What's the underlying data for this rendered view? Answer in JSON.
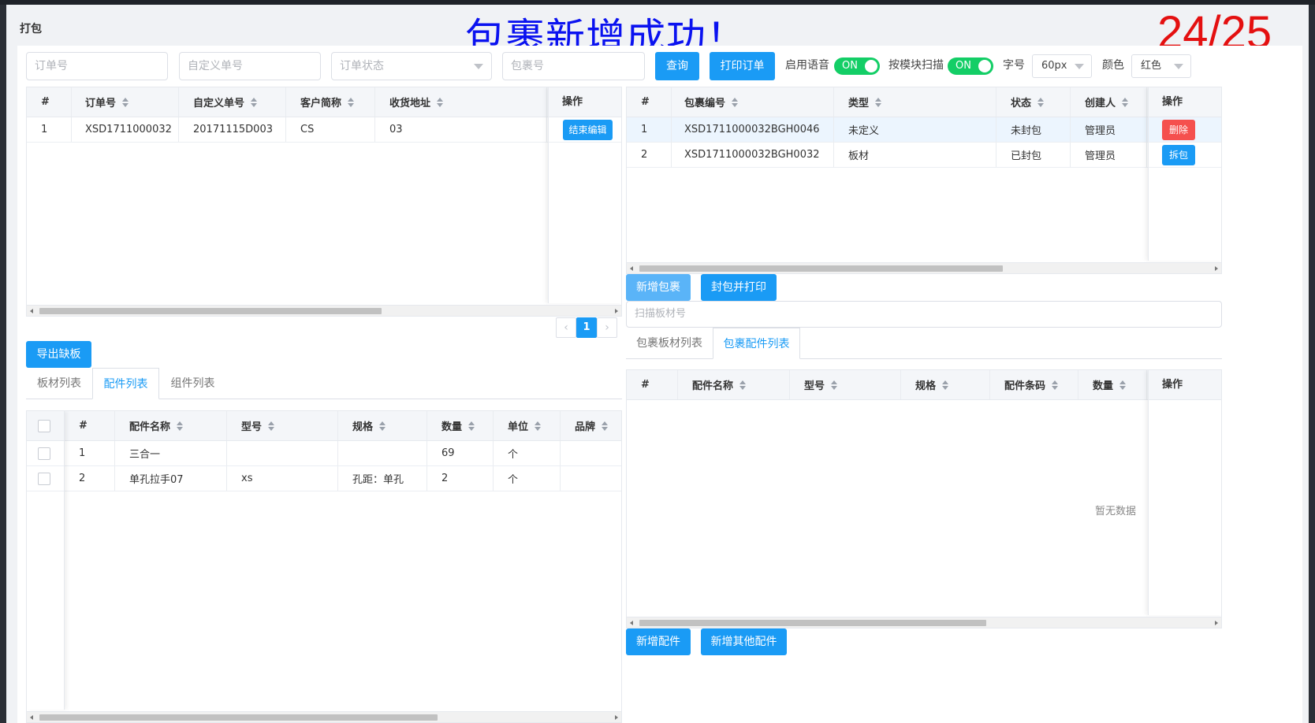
{
  "page_title": "打包",
  "success_message": "包裹新增成功！",
  "counter": "24/25",
  "filters": {
    "order_no_placeholder": "订单号",
    "custom_no_placeholder": "自定义单号",
    "order_status_placeholder": "订单状态",
    "package_no_placeholder": "包裹号",
    "query_label": "查询",
    "print_order_label": "打印订单",
    "voice_label": "启用语音",
    "voice_state": "ON",
    "module_scan_label": "按模块扫描",
    "module_scan_state": "ON",
    "font_size_label": "字号",
    "font_size_value": "60px",
    "color_label": "颜色",
    "color_value": "红色"
  },
  "orders_table": {
    "headers": [
      "#",
      "订单号",
      "自定义单号",
      "客户简称",
      "收货地址",
      "操作"
    ],
    "rows": [
      {
        "idx": "1",
        "order_no": "XSD1711000032",
        "custom_no": "20171115D003",
        "customer": "CS",
        "address": "03",
        "action": "结束编辑"
      }
    ]
  },
  "pager": {
    "prev": "‹",
    "current": "1",
    "next": "›"
  },
  "export_label": "导出缺板",
  "left_tabs": [
    "板材列表",
    "配件列表",
    "组件列表"
  ],
  "left_active_tab": 1,
  "parts_table": {
    "headers": [
      "#",
      "配件名称",
      "型号",
      "规格",
      "数量",
      "单位",
      "品牌"
    ],
    "rows": [
      {
        "idx": "1",
        "name": "三合一",
        "model": "",
        "spec": "",
        "qty": "69",
        "unit": "个",
        "brand": ""
      },
      {
        "idx": "2",
        "name": "单孔拉手07",
        "model": "xs",
        "spec": "孔距：单孔",
        "qty": "2",
        "unit": "个",
        "brand": ""
      }
    ]
  },
  "packages_table": {
    "headers": [
      "#",
      "包裹编号",
      "类型",
      "状态",
      "创建人",
      "操作"
    ],
    "rows": [
      {
        "idx": "1",
        "code": "XSD1711000032BGH0046",
        "type": "未定义",
        "status": "未封包",
        "creator": "管理员",
        "action": "删除"
      },
      {
        "idx": "2",
        "code": "XSD1711000032BGH0032",
        "type": "板材",
        "status": "已封包",
        "creator": "管理员",
        "action": "拆包"
      }
    ]
  },
  "package_buttons": {
    "add_label": "新增包裹",
    "seal_print_label": "封包并打印"
  },
  "scan_placeholder": "扫描板材号",
  "right_tabs": [
    "包裹板材列表",
    "包裹配件列表"
  ],
  "right_active_tab": 1,
  "package_parts_table": {
    "headers": [
      "#",
      "配件名称",
      "型号",
      "规格",
      "配件条码",
      "数量",
      "操作"
    ],
    "empty_text": "暂无数据"
  },
  "part_buttons": {
    "add_label": "新增配件",
    "add_other_label": "新增其他配件"
  },
  "colors": {
    "primary": "#1a9bf5",
    "danger": "#f5504e",
    "switch_on": "#13ce66",
    "message": "#0a12f0",
    "counter": "#e41010"
  }
}
